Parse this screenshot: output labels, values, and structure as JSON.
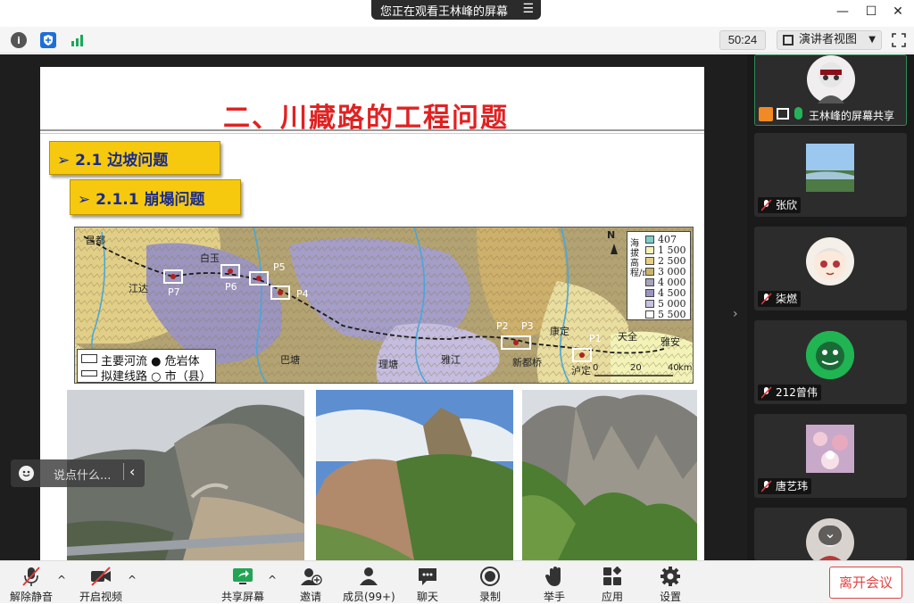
{
  "titlebar": {
    "share_notice": "您正在观看王林峰的屏幕",
    "menu_icon": "menu-icon",
    "minimize": "—",
    "maximize": "☐",
    "close": "✕"
  },
  "toolbar": {
    "timer": "50:24",
    "view_mode": "演讲者视图",
    "colors": {
      "info": "#555555",
      "shield": "#1e6fd9",
      "signal": "#19a85a"
    }
  },
  "slide": {
    "title": "二、川藏路的工程问题",
    "section": "➢ 2.1 边坡问题",
    "subsection": "➢ 2.1.1 崩塌问题",
    "map": {
      "legend_title": "海拔高程/m",
      "legend_items": [
        {
          "label": "407",
          "color": "#7ccdc7"
        },
        {
          "label": "1 500",
          "color": "#f3f3b8"
        },
        {
          "label": "2 500",
          "color": "#e5cf84"
        },
        {
          "label": "3 000",
          "color": "#cbb46a"
        },
        {
          "label": "4 000",
          "color": "#a7a2b9"
        },
        {
          "label": "4 500",
          "color": "#9c93c2"
        },
        {
          "label": "5 000",
          "color": "#c7c0de"
        },
        {
          "label": "5 500",
          "color": "#ffffff"
        }
      ],
      "key_line1": "主要河流 ● 危岩体",
      "key_line2": "拟建线路 ○ 市（县）",
      "places": {
        "changdu": "昌都",
        "jiangda": "江达",
        "batang": "巴塘",
        "litang": "理塘",
        "yajiang": "雅江",
        "xinduqiao": "新都桥",
        "kangding": "康定",
        "luding": "泸定",
        "tianquan": "天全",
        "yaan": "雅安",
        "baiyu": "白玉"
      },
      "points": {
        "p7": "P7",
        "p6": "P6",
        "p5": "P5",
        "p4": "P4",
        "p3": "P3",
        "p2": "P2",
        "p1": "P1"
      },
      "north": "N",
      "scale": [
        "0",
        "20",
        "40",
        "km"
      ]
    }
  },
  "comment": {
    "placeholder": "说点什么...",
    "arrow": "‹"
  },
  "sidebar": {
    "handle": "›",
    "participants": [
      {
        "name": "王林峰的屏幕共享"
      },
      {
        "name": "张欣"
      },
      {
        "name": "柒燃"
      },
      {
        "name": "212曾伟"
      },
      {
        "name": "唐艺玮"
      }
    ],
    "scroll_down": "⌄"
  },
  "bottombar": {
    "unmute": "解除静音",
    "start_video": "开启视频",
    "share_screen": "共享屏幕",
    "invite": "邀请",
    "members": "成员(99+)",
    "chat": "聊天",
    "record": "录制",
    "raise_hand": "举手",
    "apps": "应用",
    "settings": "设置",
    "leave": "离开会议",
    "caret": "^"
  }
}
